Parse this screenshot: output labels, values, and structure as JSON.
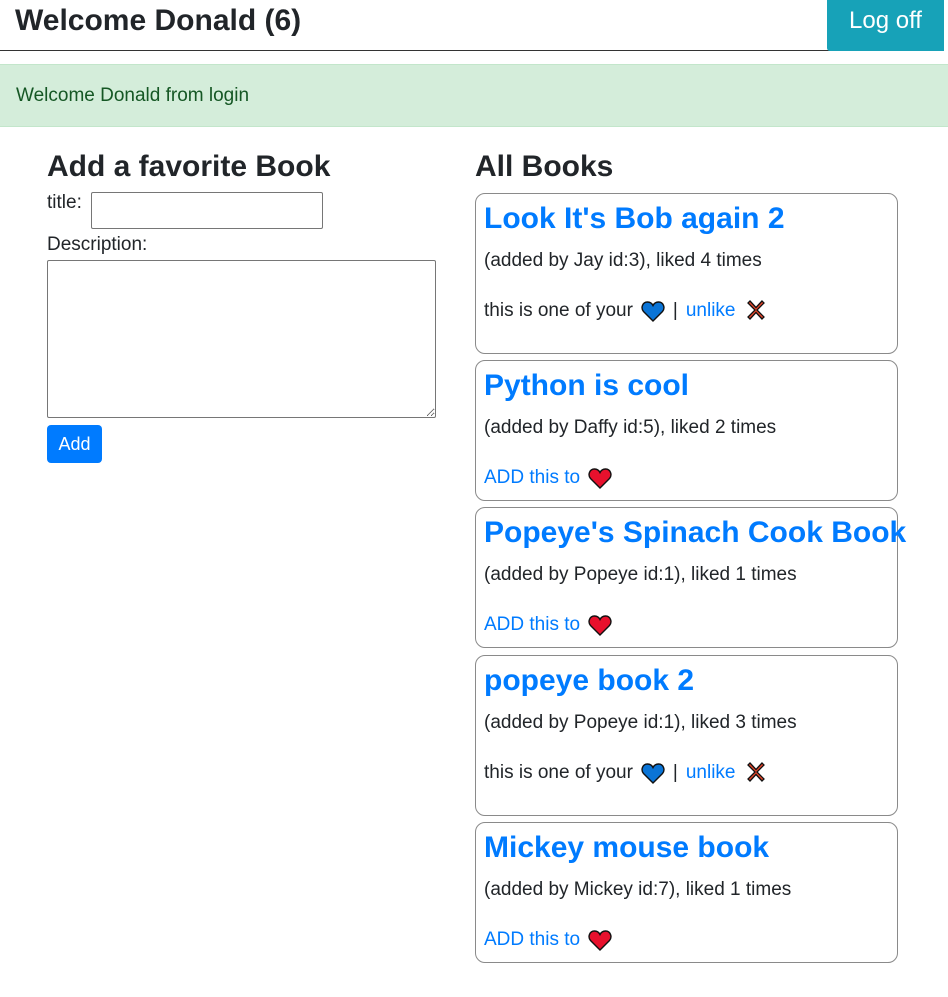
{
  "header": {
    "title": "Welcome Donald (6)",
    "logoff_label": "Log off"
  },
  "flash": {
    "message": "Welcome Donald from login"
  },
  "add_form": {
    "heading": "Add a favorite Book",
    "title_label": "title:",
    "title_value": "",
    "description_label": "Description:",
    "description_value": "",
    "add_label": "Add"
  },
  "books": {
    "heading": "All Books",
    "items": [
      {
        "title": "Look It's Bob again 2",
        "meta": "(added by Jay id:3), liked 4 times",
        "favorited": true,
        "fav_text": "this is one of your",
        "separator": "|",
        "unlike_label": "unlike",
        "add_text": ""
      },
      {
        "title": "Python is cool",
        "meta": "(added by Daffy id:5), liked 2 times",
        "favorited": false,
        "fav_text": "",
        "separator": "",
        "unlike_label": "",
        "add_text": "ADD this to"
      },
      {
        "title": "Popeye's Spinach Cook Book",
        "meta": "(added by Popeye id:1), liked 1 times",
        "favorited": false,
        "fav_text": "",
        "separator": "",
        "unlike_label": "",
        "add_text": "ADD this to"
      },
      {
        "title": "popeye book 2",
        "meta": "(added by Popeye id:1), liked 3 times",
        "favorited": true,
        "fav_text": "this is one of your",
        "separator": "|",
        "unlike_label": "unlike",
        "add_text": ""
      },
      {
        "title": "Mickey mouse book",
        "meta": "(added by Mickey id:7), liked 1 times",
        "favorited": false,
        "fav_text": "",
        "separator": "",
        "unlike_label": "",
        "add_text": "ADD this to"
      }
    ]
  },
  "colors": {
    "link": "#007bff",
    "logoff_bg": "#17a2b8",
    "flash_bg": "#d4edda",
    "flash_text": "#155724",
    "blue_heart": "#0a74d6",
    "red_heart": "#e8112d",
    "cross": "#e8462a"
  }
}
